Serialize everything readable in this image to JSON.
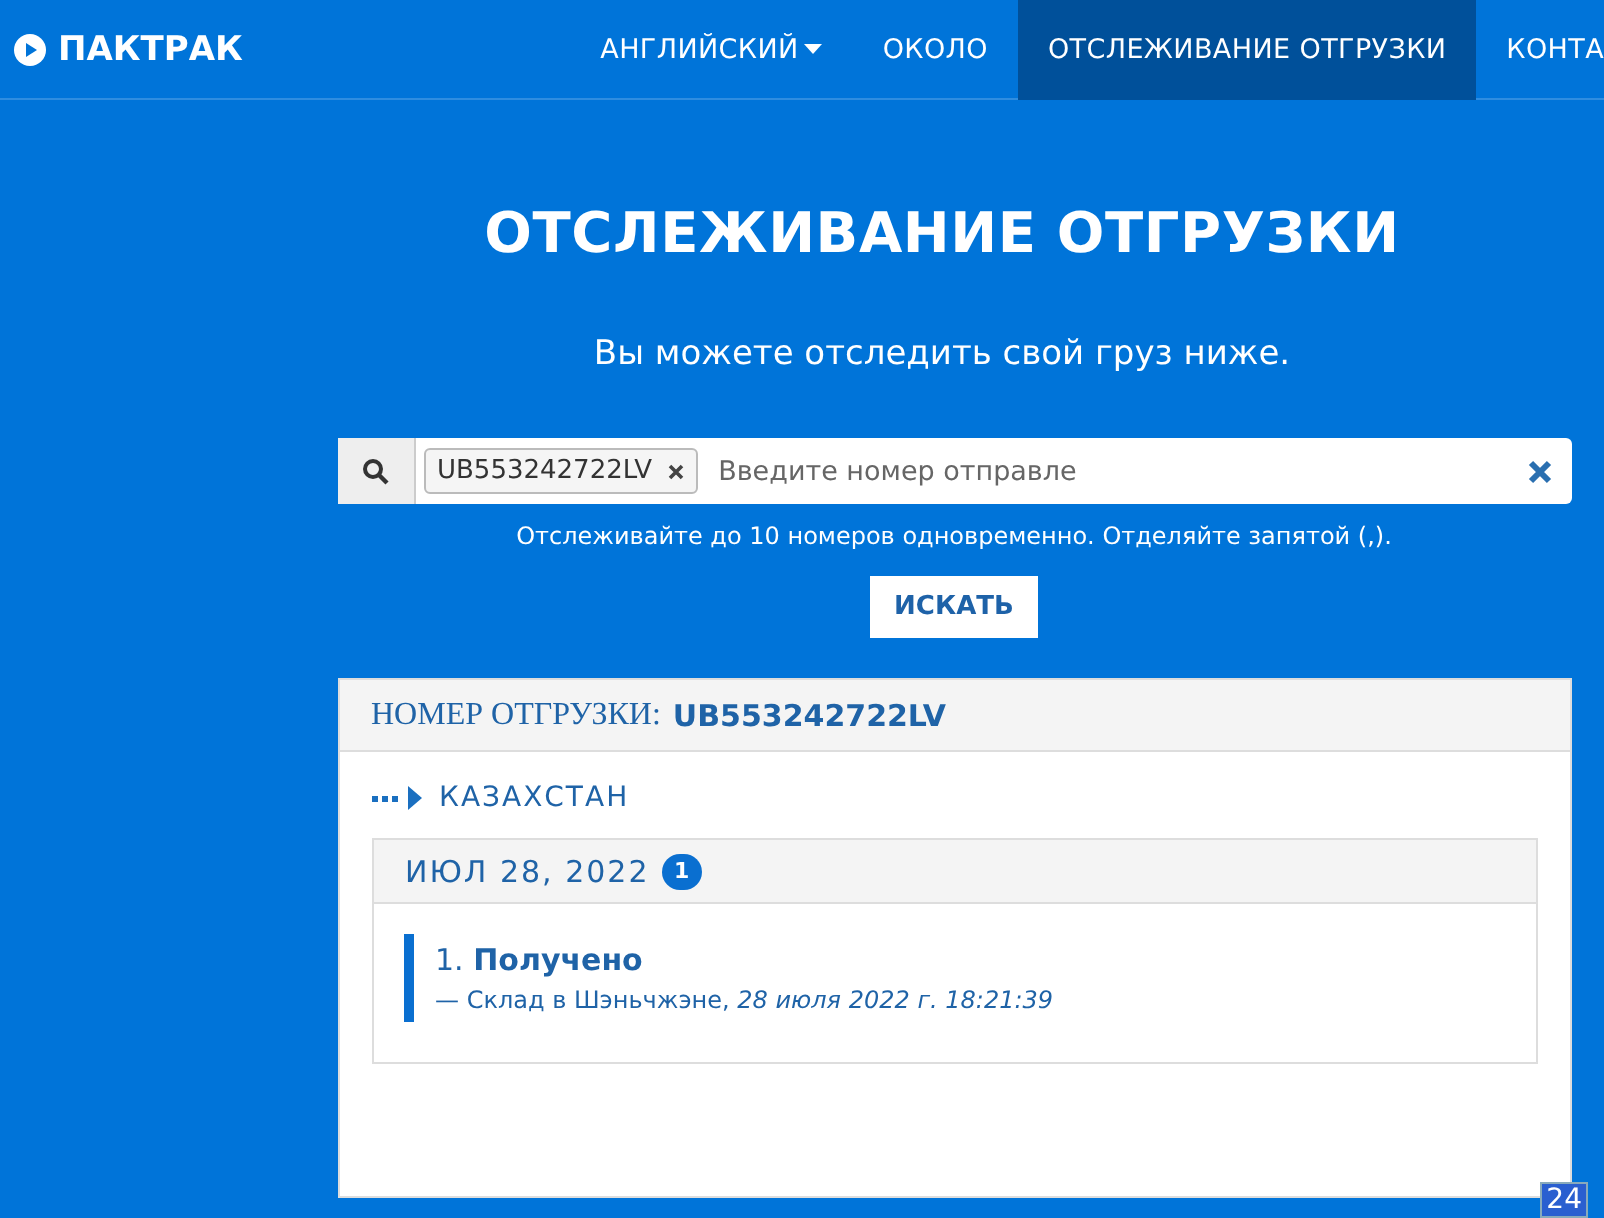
{
  "brand": "ПАКТРАК",
  "nav": [
    {
      "label": "АНГЛИЙСКИЙ",
      "dropdown": true,
      "selected": false
    },
    {
      "label": "ОКОЛО",
      "dropdown": false,
      "selected": false
    },
    {
      "label": "ОТСЛЕЖИВАНИЕ ОТГРУЗКИ",
      "dropdown": false,
      "selected": true
    },
    {
      "label": "КОНТА",
      "dropdown": false,
      "selected": false
    }
  ],
  "title": "ОТСЛЕЖИВАНИЕ ОТГРУЗКИ",
  "subtitle": "Вы можете отследить свой груз ниже.",
  "search": {
    "tags": [
      "UB553242722LV"
    ],
    "placeholder": "Введите номер отправле",
    "hint": "Отслеживайте до 10 номеров одновременно. Отделяйте запятой (,).",
    "button": "ИСКАТЬ"
  },
  "shipment": {
    "label": "НОМЕР ОТГРУЗКИ:",
    "number": "UB553242722LV",
    "route": "КАЗАХСТАН",
    "days": [
      {
        "date": "ИЮЛ 28, 2022",
        "count": "1",
        "events": [
          {
            "title": "1. **Получено**",
            "detail": "— Склад в Шэньчжэне, *28 июля 2022 г. 18:21:39*"
          }
        ]
      }
    ]
  },
  "badge": "24"
}
